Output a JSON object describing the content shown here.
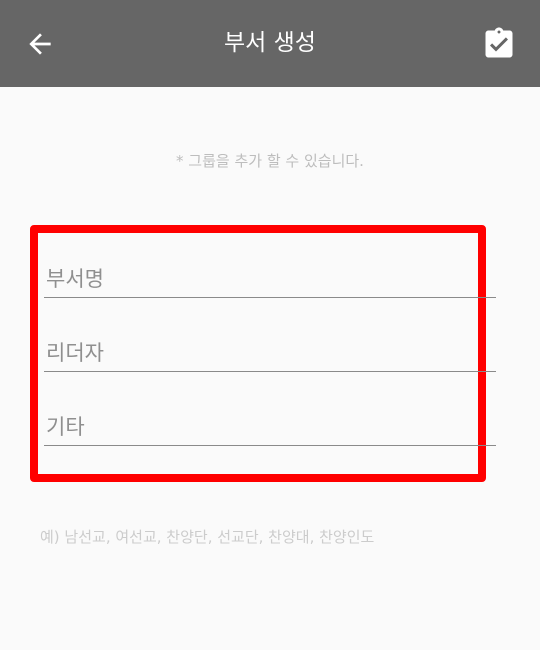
{
  "appbar": {
    "title": "부서 생성",
    "back_icon": "arrow-back-icon",
    "save_icon": "clipboard-check-icon",
    "background": "#666666"
  },
  "form": {
    "hint": "* 그룹을 추가 할 수 있습니다.",
    "fields": [
      {
        "placeholder": "부서명",
        "value": ""
      },
      {
        "placeholder": "리더자",
        "value": ""
      },
      {
        "placeholder": "기타",
        "value": ""
      }
    ],
    "example": "예) 남선교, 여선교, 찬양단, 선교단, 찬양대, 찬양인도"
  },
  "highlight": {
    "color": "#ff0000"
  }
}
